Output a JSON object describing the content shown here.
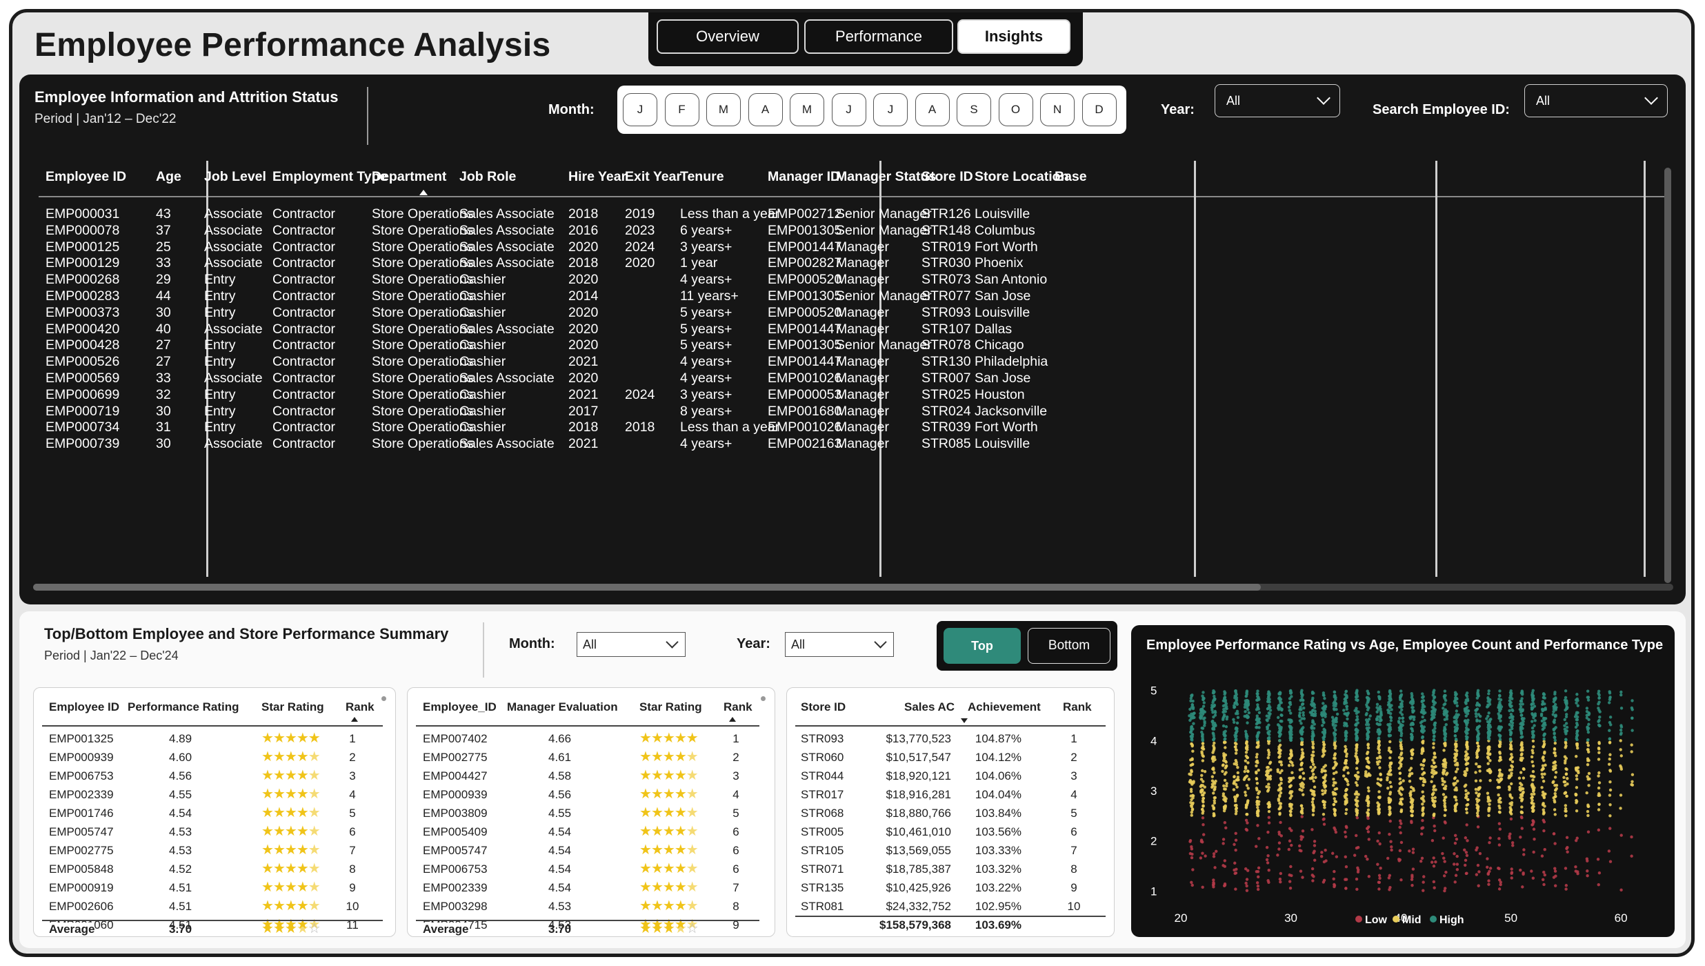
{
  "app": {
    "title": "Employee Performance Analysis"
  },
  "nav": {
    "tabs": [
      {
        "label": "Overview"
      },
      {
        "label": "Performance"
      },
      {
        "label": "Insights"
      }
    ],
    "active": "Insights"
  },
  "info": {
    "title": "Employee Information and Attrition Status",
    "period": "Period | Jan'12 – Dec'22",
    "month_label": "Month:",
    "months": [
      "J",
      "F",
      "M",
      "A",
      "M",
      "J",
      "J",
      "A",
      "S",
      "O",
      "N",
      "D"
    ],
    "year_label": "Year:",
    "year_value": "All",
    "emp_label": "Search Employee ID:",
    "emp_value": "All"
  },
  "table": {
    "headers": [
      "Employee ID",
      "Age",
      "Job Level",
      "Employment Type",
      "Department",
      "Job Role",
      "Hire Year",
      "Exit Year",
      "Tenure",
      "Manager ID",
      "Manager Status",
      "Store ID",
      "Store Location",
      "Base"
    ],
    "rows": [
      [
        "EMP000031",
        "43",
        "Associate",
        "Contractor",
        "Store Operations",
        "Sales Associate",
        "2018",
        "2019",
        "Less than a year",
        "EMP002712",
        "Senior Manager",
        "STR126",
        "Louisville"
      ],
      [
        "EMP000078",
        "37",
        "Associate",
        "Contractor",
        "Store Operations",
        "Sales Associate",
        "2016",
        "2023",
        "6 years+",
        "EMP001305",
        "Senior Manager",
        "STR148",
        "Columbus"
      ],
      [
        "EMP000125",
        "25",
        "Associate",
        "Contractor",
        "Store Operations",
        "Sales Associate",
        "2020",
        "2024",
        "3 years+",
        "EMP001447",
        "Manager",
        "STR019",
        "Fort Worth"
      ],
      [
        "EMP000129",
        "33",
        "Associate",
        "Contractor",
        "Store Operations",
        "Sales Associate",
        "2018",
        "2020",
        "1 year",
        "EMP002827",
        "Manager",
        "STR030",
        "Phoenix"
      ],
      [
        "EMP000268",
        "29",
        "Entry",
        "Contractor",
        "Store Operations",
        "Cashier",
        "2020",
        "",
        "4 years+",
        "EMP000520",
        "Manager",
        "STR073",
        "San Antonio"
      ],
      [
        "EMP000283",
        "44",
        "Entry",
        "Contractor",
        "Store Operations",
        "Cashier",
        "2014",
        "",
        "11 years+",
        "EMP001305",
        "Senior Manager",
        "STR077",
        "San Jose"
      ],
      [
        "EMP000373",
        "30",
        "Entry",
        "Contractor",
        "Store Operations",
        "Cashier",
        "2020",
        "",
        "5 years+",
        "EMP000520",
        "Manager",
        "STR093",
        "Louisville"
      ],
      [
        "EMP000420",
        "40",
        "Associate",
        "Contractor",
        "Store Operations",
        "Sales Associate",
        "2020",
        "",
        "5 years+",
        "EMP001447",
        "Manager",
        "STR107",
        "Dallas"
      ],
      [
        "EMP000428",
        "27",
        "Entry",
        "Contractor",
        "Store Operations",
        "Cashier",
        "2020",
        "",
        "5 years+",
        "EMP001305",
        "Senior Manager",
        "STR078",
        "Chicago"
      ],
      [
        "EMP000526",
        "27",
        "Entry",
        "Contractor",
        "Store Operations",
        "Cashier",
        "2021",
        "",
        "4 years+",
        "EMP001447",
        "Manager",
        "STR130",
        "Philadelphia"
      ],
      [
        "EMP000569",
        "33",
        "Associate",
        "Contractor",
        "Store Operations",
        "Sales Associate",
        "2020",
        "",
        "4 years+",
        "EMP001026",
        "Manager",
        "STR007",
        "San Jose"
      ],
      [
        "EMP000699",
        "32",
        "Entry",
        "Contractor",
        "Store Operations",
        "Cashier",
        "2021",
        "2024",
        "3 years+",
        "EMP000053",
        "Manager",
        "STR025",
        "Houston"
      ],
      [
        "EMP000719",
        "30",
        "Entry",
        "Contractor",
        "Store Operations",
        "Cashier",
        "2017",
        "",
        "8 years+",
        "EMP001680",
        "Manager",
        "STR024",
        "Jacksonville"
      ],
      [
        "EMP000734",
        "31",
        "Entry",
        "Contractor",
        "Store Operations",
        "Cashier",
        "2018",
        "2018",
        "Less than a year",
        "EMP001026",
        "Manager",
        "STR039",
        "Fort Worth"
      ],
      [
        "EMP000739",
        "30",
        "Associate",
        "Contractor",
        "Store Operations",
        "Sales Associate",
        "2021",
        "",
        "4 years+",
        "EMP002163",
        "Manager",
        "STR085",
        "Louisville"
      ]
    ]
  },
  "summary": {
    "title": "Top/Bottom Employee and Store Performance Summary",
    "period": "Period | Jan'22 – Dec'24",
    "month_label": "Month:",
    "month_value": "All",
    "year_label": "Year:",
    "year_value": "All",
    "toggle": {
      "top": "Top",
      "bottom": "Bottom",
      "active": "Top"
    }
  },
  "perf_table": {
    "headers": [
      "Employee ID",
      "Performance Rating",
      "Star Rating",
      "Rank"
    ],
    "rows": [
      {
        "id": "EMP001325",
        "rating": "4.89",
        "stars": 5,
        "rank": "1"
      },
      {
        "id": "EMP000939",
        "rating": "4.60",
        "stars": 4.5,
        "rank": "2"
      },
      {
        "id": "EMP006753",
        "rating": "4.56",
        "stars": 4.5,
        "rank": "3"
      },
      {
        "id": "EMP002339",
        "rating": "4.55",
        "stars": 4.5,
        "rank": "4"
      },
      {
        "id": "EMP001746",
        "rating": "4.54",
        "stars": 4.5,
        "rank": "5"
      },
      {
        "id": "EMP005747",
        "rating": "4.53",
        "stars": 4.5,
        "rank": "6"
      },
      {
        "id": "EMP002775",
        "rating": "4.53",
        "stars": 4.5,
        "rank": "7"
      },
      {
        "id": "EMP005848",
        "rating": "4.52",
        "stars": 4.5,
        "rank": "8"
      },
      {
        "id": "EMP000919",
        "rating": "4.51",
        "stars": 4.5,
        "rank": "9"
      },
      {
        "id": "EMP002606",
        "rating": "4.51",
        "stars": 4.5,
        "rank": "10"
      },
      {
        "id": "EMP001060",
        "rating": "4.51",
        "stars": 4.5,
        "rank": "11"
      }
    ],
    "total_label": "Average",
    "total_rating": "3.70",
    "total_stars": 3.5
  },
  "mgr_table": {
    "headers": [
      "Employee_ID",
      "Manager Evaluation",
      "Star Rating",
      "Rank"
    ],
    "rows": [
      {
        "id": "EMP007402",
        "rating": "4.66",
        "stars": 5,
        "rank": "1"
      },
      {
        "id": "EMP002775",
        "rating": "4.61",
        "stars": 4.5,
        "rank": "2"
      },
      {
        "id": "EMP004427",
        "rating": "4.58",
        "stars": 4.5,
        "rank": "3"
      },
      {
        "id": "EMP000939",
        "rating": "4.56",
        "stars": 4.5,
        "rank": "4"
      },
      {
        "id": "EMP003809",
        "rating": "4.55",
        "stars": 4.5,
        "rank": "5"
      },
      {
        "id": "EMP005409",
        "rating": "4.54",
        "stars": 4.5,
        "rank": "6"
      },
      {
        "id": "EMP005747",
        "rating": "4.54",
        "stars": 4.5,
        "rank": "6"
      },
      {
        "id": "EMP006753",
        "rating": "4.54",
        "stars": 4.5,
        "rank": "6"
      },
      {
        "id": "EMP002339",
        "rating": "4.54",
        "stars": 4.5,
        "rank": "7"
      },
      {
        "id": "EMP003298",
        "rating": "4.53",
        "stars": 4.5,
        "rank": "8"
      },
      {
        "id": "EMP004715",
        "rating": "4.53",
        "stars": 4.5,
        "rank": "9"
      }
    ],
    "total_label": "Average",
    "total_rating": "3.70",
    "total_stars": 3.5
  },
  "store_table": {
    "headers": [
      "Store ID",
      "Sales AC",
      "Achievement",
      "Rank"
    ],
    "rows": [
      {
        "id": "STR093",
        "sales": "$13,770,523",
        "ach": "104.87%",
        "rank": "1"
      },
      {
        "id": "STR060",
        "sales": "$10,517,547",
        "ach": "104.12%",
        "rank": "2"
      },
      {
        "id": "STR044",
        "sales": "$18,920,121",
        "ach": "104.06%",
        "rank": "3"
      },
      {
        "id": "STR017",
        "sales": "$18,916,281",
        "ach": "104.04%",
        "rank": "4"
      },
      {
        "id": "STR068",
        "sales": "$18,880,766",
        "ach": "103.84%",
        "rank": "5"
      },
      {
        "id": "STR005",
        "sales": "$10,461,010",
        "ach": "103.56%",
        "rank": "6"
      },
      {
        "id": "STR105",
        "sales": "$13,569,055",
        "ach": "103.33%",
        "rank": "7"
      },
      {
        "id": "STR071",
        "sales": "$18,785,387",
        "ach": "103.32%",
        "rank": "8"
      },
      {
        "id": "STR135",
        "sales": "$10,425,926",
        "ach": "103.22%",
        "rank": "9"
      },
      {
        "id": "STR081",
        "sales": "$24,332,752",
        "ach": "102.95%",
        "rank": "10"
      }
    ],
    "total_sales": "$158,579,368",
    "total_ach": "103.69%"
  },
  "chart_data": {
    "type": "scatter",
    "title": "Employee Performance Rating vs Age, Employee Count and Performance Type",
    "xlabel": "",
    "ylabel": "",
    "x_ticks": [
      "20",
      "30",
      "40",
      "50",
      "60"
    ],
    "y_ticks": [
      "5",
      "4",
      "3",
      "2",
      "1"
    ],
    "xlim": [
      20,
      62
    ],
    "ylim": [
      0.8,
      5.2
    ],
    "ages": [
      21,
      22,
      23,
      24,
      25,
      26,
      27,
      28,
      29,
      30,
      31,
      32,
      33,
      34,
      35,
      36,
      37,
      38,
      39,
      40,
      41,
      42,
      43,
      44,
      45,
      46,
      47,
      48,
      49,
      50,
      51,
      52,
      53,
      54,
      55,
      56,
      57,
      58,
      59,
      60,
      61
    ],
    "series": [
      {
        "name": "Low",
        "color": "#b23a48",
        "range": [
          1.0,
          2.5
        ]
      },
      {
        "name": "Mid",
        "color": "#e8cc5a",
        "range": [
          2.5,
          4.0
        ]
      },
      {
        "name": "High",
        "color": "#2e8b7a",
        "range": [
          4.0,
          5.0
        ]
      }
    ],
    "legend": "bottom",
    "grid": false
  }
}
